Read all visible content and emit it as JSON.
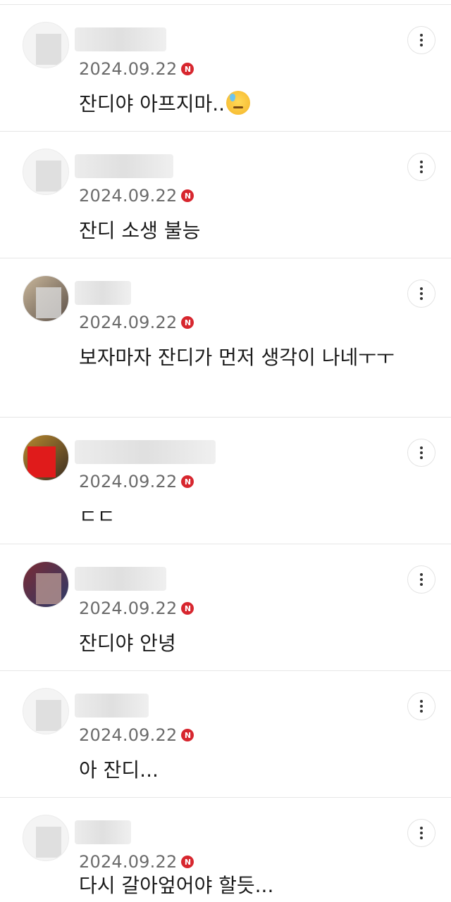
{
  "comments": [
    {
      "date": "2024.09.22",
      "badge": "N",
      "text": "잔디야 아프지마..",
      "emoji": "sad-sweat-face-emoji"
    },
    {
      "date": "2024.09.22",
      "badge": "N",
      "text": "잔디 소생 불능"
    },
    {
      "date": "2024.09.22",
      "badge": "N",
      "text": "보자마자 잔디가 먼저 생각이 나네ㅜㅜ"
    },
    {
      "date": "2024.09.22",
      "badge": "N",
      "text": "ㄷㄷ"
    },
    {
      "date": "2024.09.22",
      "badge": "N",
      "text": "잔디야 안녕"
    },
    {
      "date": "2024.09.22",
      "badge": "N",
      "text": "아 잔디..."
    },
    {
      "date": "2024.09.22",
      "badge": "N",
      "text": "다시 갈아엎어야 할듯..."
    }
  ],
  "icons": {
    "more": "more-vertical-icon",
    "new_badge": "new-badge-icon"
  },
  "colors": {
    "badge": "#d7262e",
    "date": "#6b6b6b",
    "divider": "#e6e6e6"
  }
}
